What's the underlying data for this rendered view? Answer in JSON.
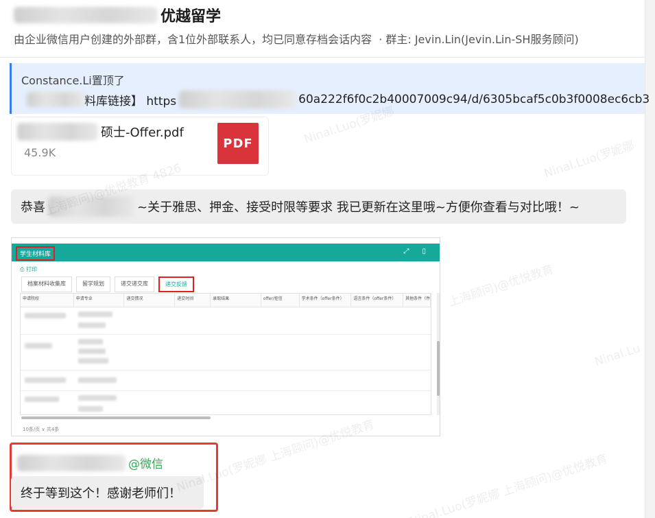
{
  "header": {
    "group_title": "优越留学",
    "group_info": "由企业微信用户创建的外部群，含1位外部联系人，均已同意存档会话内容",
    "group_owner": "· 群主: Jevin.Lin(Jevin.Lin-SH服务顾问)"
  },
  "pinned": {
    "pinned_by": "Constance.Li置顶了",
    "link_prefix": "料库链接】 https",
    "link_suffix": "60a222f6f0c2b40007009c94/d/6305bcaf5c0b3f0008ec6cb3"
  },
  "file_card": {
    "name": "硕士-Offer.pdf",
    "size": "45.9K",
    "icon_label": "PDF"
  },
  "message_1": {
    "prefix": "恭喜",
    "text": "~关于雅思、押金、接受时限等要求 我已更新在这里哦~方便你查看与对比哦！~"
  },
  "screenshot": {
    "title": "学生材料库",
    "print_label": "打印",
    "tabs": [
      "档案材料收集库",
      "留学规划",
      "递交递交库",
      "递交反馈"
    ],
    "columns": [
      "申请院校",
      "申请专业",
      "递交情况",
      "递交时间",
      "录取结果",
      "offer/拒信",
      "学术条件（offer条件）",
      "语言条件（offer条件）",
      "其他条件（件）"
    ],
    "footer": "10条/页 ∨ 共4条"
  },
  "message_2": {
    "sender_suffix": "@微信",
    "text": "终于等到这个！感谢老师们！"
  },
  "watermarks": [
    "Ninal.Luo(罗妮娜",
    "Ninal.Luo(罗妮娜",
    "上海顾问)@优悦教育 4826",
    "上海顾问)@优悦教育",
    "Ninal.Lu",
    "Ninal.Luo(罗妮娜 上海顾问)@优悦教育",
    "Ninal.Luo(罗妮娜 上海顾问)@优悦教育"
  ]
}
